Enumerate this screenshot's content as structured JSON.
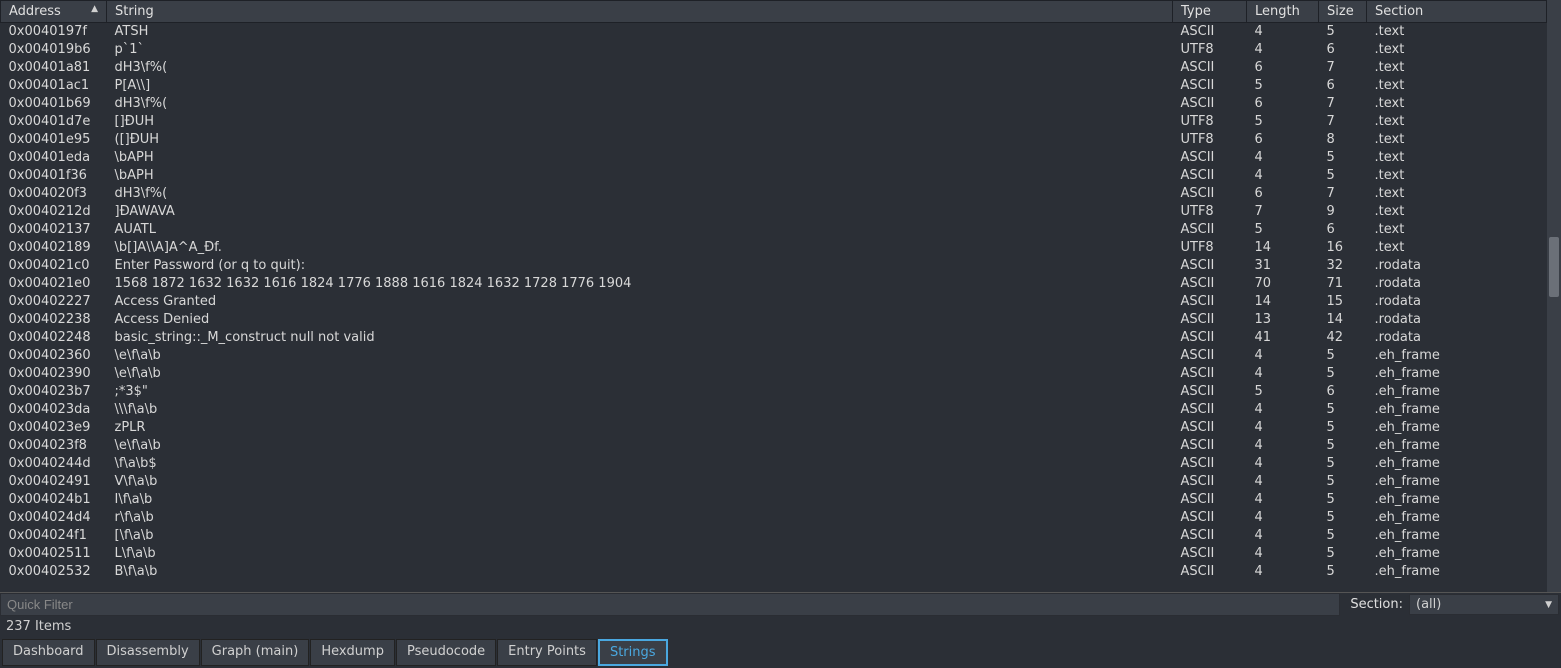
{
  "columns": {
    "address": "Address",
    "string": "String",
    "type": "Type",
    "length": "Length",
    "size": "Size",
    "section": "Section"
  },
  "rows": [
    {
      "addr": "0x0040197f",
      "str": "ATSH",
      "type": "ASCII",
      "len": "4",
      "size": "5",
      "sec": ".text"
    },
    {
      "addr": "0x004019b6",
      "str": "p`1`",
      "type": "UTF8",
      "len": "4",
      "size": "6",
      "sec": ".text"
    },
    {
      "addr": "0x00401a81",
      "str": "dH3\\f%(",
      "type": "ASCII",
      "len": "6",
      "size": "7",
      "sec": ".text"
    },
    {
      "addr": "0x00401ac1",
      "str": "P[A\\\\]",
      "type": "ASCII",
      "len": "5",
      "size": "6",
      "sec": ".text"
    },
    {
      "addr": "0x00401b69",
      "str": "dH3\\f%(",
      "type": "ASCII",
      "len": "6",
      "size": "7",
      "sec": ".text"
    },
    {
      "addr": "0x00401d7e",
      "str": "[]ĐUH",
      "type": "UTF8",
      "len": "5",
      "size": "7",
      "sec": ".text"
    },
    {
      "addr": "0x00401e95",
      "str": "([]ĐUH",
      "type": "UTF8",
      "len": "6",
      "size": "8",
      "sec": ".text"
    },
    {
      "addr": "0x00401eda",
      "str": "\\bAPH",
      "type": "ASCII",
      "len": "4",
      "size": "5",
      "sec": ".text"
    },
    {
      "addr": "0x00401f36",
      "str": "\\bAPH",
      "type": "ASCII",
      "len": "4",
      "size": "5",
      "sec": ".text"
    },
    {
      "addr": "0x004020f3",
      "str": "dH3\\f%(",
      "type": "ASCII",
      "len": "6",
      "size": "7",
      "sec": ".text"
    },
    {
      "addr": "0x0040212d",
      "str": "]ĐAWAVA",
      "type": "UTF8",
      "len": "7",
      "size": "9",
      "sec": ".text"
    },
    {
      "addr": "0x00402137",
      "str": "AUATL",
      "type": "ASCII",
      "len": "5",
      "size": "6",
      "sec": ".text"
    },
    {
      "addr": "0x00402189",
      "str": "\\b[]A\\\\A]A^A_Đf.",
      "type": "UTF8",
      "len": "14",
      "size": "16",
      "sec": ".text"
    },
    {
      "addr": "0x004021c0",
      "str": "Enter Password (or q to quit):",
      "type": "ASCII",
      "len": "31",
      "size": "32",
      "sec": ".rodata"
    },
    {
      "addr": "0x004021e0",
      "str": "1568 1872 1632 1632 1616 1824 1776 1888 1616 1824 1632 1728 1776 1904",
      "type": "ASCII",
      "len": "70",
      "size": "71",
      "sec": ".rodata"
    },
    {
      "addr": "0x00402227",
      "str": "Access Granted",
      "type": "ASCII",
      "len": "14",
      "size": "15",
      "sec": ".rodata"
    },
    {
      "addr": "0x00402238",
      "str": "Access Denied",
      "type": "ASCII",
      "len": "13",
      "size": "14",
      "sec": ".rodata"
    },
    {
      "addr": "0x00402248",
      "str": "basic_string::_M_construct null not valid",
      "type": "ASCII",
      "len": "41",
      "size": "42",
      "sec": ".rodata"
    },
    {
      "addr": "0x00402360",
      "str": "\\e\\f\\a\\b",
      "type": "ASCII",
      "len": "4",
      "size": "5",
      "sec": ".eh_frame"
    },
    {
      "addr": "0x00402390",
      "str": "\\e\\f\\a\\b",
      "type": "ASCII",
      "len": "4",
      "size": "5",
      "sec": ".eh_frame"
    },
    {
      "addr": "0x004023b7",
      "str": ";*3$\"",
      "type": "ASCII",
      "len": "5",
      "size": "6",
      "sec": ".eh_frame"
    },
    {
      "addr": "0x004023da",
      "str": "\\\\\\f\\a\\b",
      "type": "ASCII",
      "len": "4",
      "size": "5",
      "sec": ".eh_frame"
    },
    {
      "addr": "0x004023e9",
      "str": "zPLR",
      "type": "ASCII",
      "len": "4",
      "size": "5",
      "sec": ".eh_frame"
    },
    {
      "addr": "0x004023f8",
      "str": "\\e\\f\\a\\b",
      "type": "ASCII",
      "len": "4",
      "size": "5",
      "sec": ".eh_frame"
    },
    {
      "addr": "0x0040244d",
      "str": "\\f\\a\\b$",
      "type": "ASCII",
      "len": "4",
      "size": "5",
      "sec": ".eh_frame"
    },
    {
      "addr": "0x00402491",
      "str": "V\\f\\a\\b",
      "type": "ASCII",
      "len": "4",
      "size": "5",
      "sec": ".eh_frame"
    },
    {
      "addr": "0x004024b1",
      "str": "I\\f\\a\\b",
      "type": "ASCII",
      "len": "4",
      "size": "5",
      "sec": ".eh_frame"
    },
    {
      "addr": "0x004024d4",
      "str": "r\\f\\a\\b",
      "type": "ASCII",
      "len": "4",
      "size": "5",
      "sec": ".eh_frame"
    },
    {
      "addr": "0x004024f1",
      "str": "[\\f\\a\\b",
      "type": "ASCII",
      "len": "4",
      "size": "5",
      "sec": ".eh_frame"
    },
    {
      "addr": "0x00402511",
      "str": "L\\f\\a\\b",
      "type": "ASCII",
      "len": "4",
      "size": "5",
      "sec": ".eh_frame"
    },
    {
      "addr": "0x00402532",
      "str": "B\\f\\a\\b",
      "type": "ASCII",
      "len": "4",
      "size": "5",
      "sec": ".eh_frame"
    }
  ],
  "filter": {
    "placeholder": "Quick Filter",
    "section_label": "Section:",
    "section_value": "(all)"
  },
  "status": {
    "items": "237 Items"
  },
  "tabs": [
    {
      "label": "Dashboard"
    },
    {
      "label": "Disassembly"
    },
    {
      "label": "Graph (main)"
    },
    {
      "label": "Hexdump"
    },
    {
      "label": "Pseudocode"
    },
    {
      "label": "Entry Points"
    },
    {
      "label": "Strings"
    }
  ],
  "active_tab": 6
}
